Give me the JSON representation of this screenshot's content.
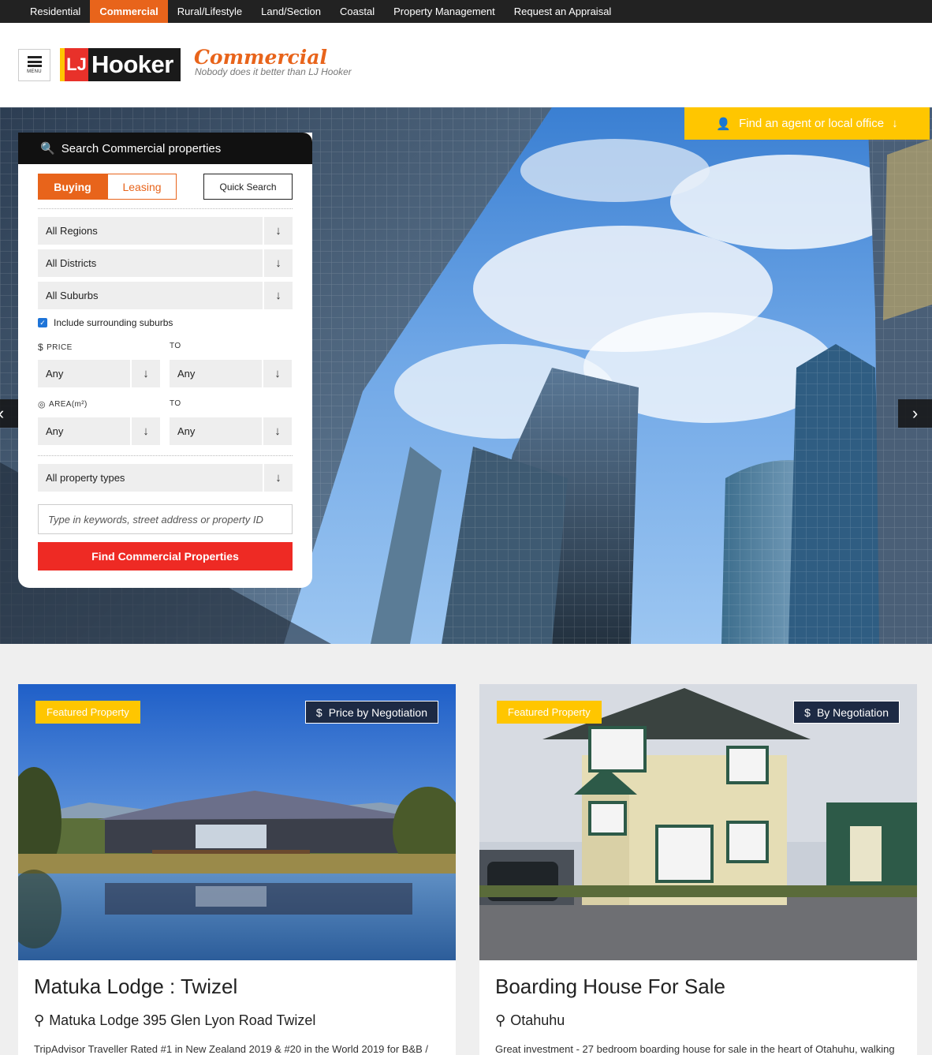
{
  "topnav": {
    "items": [
      {
        "label": "Residential"
      },
      {
        "label": "Commercial"
      },
      {
        "label": "Rural/Lifestyle"
      },
      {
        "label": "Land/Section"
      },
      {
        "label": "Coastal"
      },
      {
        "label": "Property Management"
      },
      {
        "label": "Request an Appraisal"
      }
    ],
    "active": "Commercial"
  },
  "header": {
    "menu_label": "MENU",
    "logo_mark": "LJ",
    "logo_word": "Hooker",
    "brand_title": "Commercial",
    "tagline": "Nobody does it better than LJ Hooker"
  },
  "hero": {
    "find_agent_label": "Find an agent or local office",
    "colors": {
      "accent_yellow": "#ffc600",
      "accent_orange": "#e8641b",
      "cta_red": "#ee2a24"
    }
  },
  "search": {
    "title": "Search Commercial properties",
    "tabs": {
      "buying": "Buying",
      "leasing": "Leasing"
    },
    "active_tab": "Buying",
    "quick_search": "Quick Search",
    "regions": "All Regions",
    "districts": "All Districts",
    "suburbs": "All Suburbs",
    "include_surrounding": "Include surrounding suburbs",
    "include_surrounding_checked": true,
    "price_label": "PRICE",
    "to_label": "TO",
    "price_from": "Any",
    "price_to": "Any",
    "area_label": "AREA(m²)",
    "area_from": "Any",
    "area_to": "Any",
    "property_types": "All property types",
    "keyword_placeholder": "Type in keywords, street address or property ID",
    "submit": "Find Commercial Properties"
  },
  "listings": [
    {
      "badge": "Featured Property",
      "price": "Price by Negotiation",
      "title": "Matuka Lodge : Twizel",
      "address": "Matuka Lodge 395 Glen Lyon Road Twizel",
      "description": "TripAdvisor Traveller Rated #1 in New Zealand 2019 & #20 in the World 2019 for B&B /"
    },
    {
      "badge": "Featured Property",
      "price": "By Negotiation",
      "title": "Boarding House For Sale",
      "address": "Otahuhu",
      "description": "Great investment - 27 bedroom boarding house for sale in the heart of Otahuhu, walking"
    }
  ]
}
